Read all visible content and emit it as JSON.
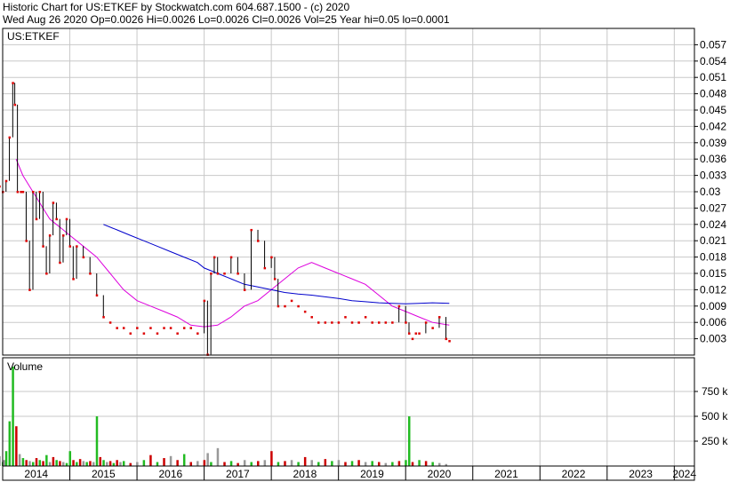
{
  "header": {
    "line1": "Historic Chart for US:ETKEF by Stockwatch.com 604.687.1500 - (c) 2020",
    "line2": "Wed Aug 26 2020   Op=0.0026  Hi=0.0026  Lo=0.0026  Cl=0.0026  Vol=25   Year hi=0.05   lo=0.0001"
  },
  "colors": {
    "price": "#dd0000",
    "ma_short": "#dd00dd",
    "ma_long": "#0000cc",
    "vol_up": "#22bb22",
    "vol_down": "#cc0000",
    "vol_flat": "#999999",
    "grid": "#c8c8c8"
  },
  "chart_data": [
    {
      "type": "line",
      "title": "US:ETKEF",
      "x_ticks": [
        "2014",
        "2015",
        "2016",
        "2017",
        "2018",
        "2019",
        "2020",
        "2021",
        "2022",
        "2023",
        "2024"
      ],
      "y_ticks": [
        "0.057",
        "0.054",
        "0.051",
        "0.048",
        "0.045",
        "0.042",
        "0.039",
        "0.036",
        "0.033",
        "0.03",
        "0.027",
        "0.024",
        "0.021",
        "0.018",
        "0.015",
        "0.012",
        "0.009",
        "0.006",
        "0.003"
      ],
      "xlim": [
        2014.0,
        2024.3
      ],
      "ylim": [
        0.0,
        0.06
      ],
      "grid": true,
      "series": [
        {
          "key": "price",
          "x": [
            2013.9,
            2013.95,
            2014.0,
            2014.05,
            2014.1,
            2014.15,
            2014.18,
            2014.22,
            2014.27,
            2014.3,
            2014.35,
            2014.4,
            2014.45,
            2014.5,
            2014.55,
            2014.6,
            2014.65,
            2014.7,
            2014.75,
            2014.8,
            2014.85,
            2014.9,
            2014.95,
            2015.0,
            2015.05,
            2015.1,
            2015.2,
            2015.3,
            2015.4,
            2015.5,
            2015.6,
            2015.7,
            2015.8,
            2015.9,
            2016.0,
            2016.1,
            2016.2,
            2016.3,
            2016.4,
            2016.5,
            2016.6,
            2016.7,
            2016.8,
            2016.9,
            2017.0,
            2017.05,
            2017.1,
            2017.15,
            2017.2,
            2017.3,
            2017.4,
            2017.5,
            2017.6,
            2017.7,
            2017.8,
            2017.9,
            2018.0,
            2018.05,
            2018.1,
            2018.2,
            2018.3,
            2018.4,
            2018.5,
            2018.6,
            2018.7,
            2018.8,
            2018.9,
            2019.0,
            2019.1,
            2019.2,
            2019.3,
            2019.4,
            2019.5,
            2019.6,
            2019.7,
            2019.8,
            2019.9,
            2020.0,
            2020.05,
            2020.1,
            2020.15,
            2020.2,
            2020.3,
            2020.4,
            2020.5,
            2020.6,
            2020.65
          ],
          "y": [
            0.036,
            0.031,
            0.03,
            0.032,
            0.04,
            0.05,
            0.046,
            0.03,
            0.03,
            0.03,
            0.021,
            0.012,
            0.03,
            0.025,
            0.03,
            0.02,
            0.015,
            0.022,
            0.028,
            0.025,
            0.017,
            0.022,
            0.025,
            0.02,
            0.014,
            0.02,
            0.018,
            0.015,
            0.011,
            0.007,
            0.006,
            0.005,
            0.005,
            0.004,
            0.005,
            0.004,
            0.005,
            0.004,
            0.005,
            0.005,
            0.004,
            0.005,
            0.005,
            0.004,
            0.01,
            0.0001,
            0.015,
            0.018,
            0.015,
            0.015,
            0.018,
            0.015,
            0.012,
            0.023,
            0.021,
            0.016,
            0.018,
            0.014,
            0.009,
            0.009,
            0.01,
            0.009,
            0.008,
            0.007,
            0.006,
            0.006,
            0.006,
            0.006,
            0.007,
            0.006,
            0.006,
            0.007,
            0.006,
            0.006,
            0.006,
            0.006,
            0.009,
            0.006,
            0.004,
            0.003,
            0.004,
            0.004,
            0.006,
            0.005,
            0.007,
            0.003,
            0.0026
          ]
        },
        {
          "key": "ma_short",
          "x": [
            2014.2,
            2014.3,
            2014.4,
            2014.5,
            2014.6,
            2014.7,
            2014.8,
            2014.9,
            2015.0,
            2015.2,
            2015.4,
            2015.6,
            2015.8,
            2016.0,
            2016.2,
            2016.4,
            2016.6,
            2016.8,
            2017.0,
            2017.2,
            2017.4,
            2017.6,
            2017.8,
            2018.0,
            2018.2,
            2018.4,
            2018.6,
            2018.8,
            2019.0,
            2019.2,
            2019.4,
            2019.6,
            2019.8,
            2020.0,
            2020.2,
            2020.4,
            2020.65
          ],
          "y": [
            0.036,
            0.033,
            0.031,
            0.029,
            0.027,
            0.025,
            0.024,
            0.023,
            0.022,
            0.02,
            0.018,
            0.015,
            0.012,
            0.01,
            0.009,
            0.008,
            0.007,
            0.0055,
            0.0052,
            0.0055,
            0.007,
            0.009,
            0.01,
            0.012,
            0.014,
            0.016,
            0.017,
            0.016,
            0.015,
            0.014,
            0.013,
            0.011,
            0.009,
            0.008,
            0.007,
            0.006,
            0.0055
          ]
        },
        {
          "key": "ma_long",
          "x": [
            2015.5,
            2015.7,
            2015.9,
            2016.1,
            2016.3,
            2016.5,
            2016.7,
            2016.9,
            2017.0,
            2017.2,
            2017.4,
            2017.6,
            2017.8,
            2018.0,
            2018.2,
            2018.4,
            2018.6,
            2018.8,
            2019.0,
            2019.2,
            2019.4,
            2019.6,
            2019.8,
            2020.0,
            2020.2,
            2020.4,
            2020.65
          ],
          "y": [
            0.024,
            0.023,
            0.022,
            0.021,
            0.02,
            0.019,
            0.018,
            0.017,
            0.016,
            0.015,
            0.014,
            0.013,
            0.0125,
            0.012,
            0.0115,
            0.0112,
            0.011,
            0.0107,
            0.0104,
            0.01,
            0.0098,
            0.0096,
            0.0095,
            0.0094,
            0.0095,
            0.0096,
            0.0095
          ]
        }
      ]
    },
    {
      "type": "bar",
      "title": "Volume",
      "y_ticks": [
        "750 k",
        "500 k",
        "250 k"
      ],
      "y_tick_values": [
        750000,
        500000,
        250000
      ],
      "ylim": [
        0,
        1000000
      ],
      "xlim": [
        2014.0,
        2024.3
      ],
      "bars": {
        "x": [
          2013.95,
          2014.0,
          2014.02,
          2014.05,
          2014.1,
          2014.15,
          2014.2,
          2014.25,
          2014.3,
          2014.35,
          2014.4,
          2014.45,
          2014.5,
          2014.55,
          2014.6,
          2014.65,
          2014.7,
          2014.75,
          2014.8,
          2014.85,
          2014.9,
          2014.95,
          2015.0,
          2015.05,
          2015.1,
          2015.15,
          2015.2,
          2015.25,
          2015.3,
          2015.35,
          2015.4,
          2015.45,
          2015.5,
          2015.55,
          2015.6,
          2015.65,
          2015.7,
          2015.75,
          2015.8,
          2015.9,
          2016.0,
          2016.1,
          2016.2,
          2016.3,
          2016.4,
          2016.5,
          2016.6,
          2016.7,
          2016.8,
          2016.9,
          2017.0,
          2017.05,
          2017.1,
          2017.2,
          2017.3,
          2017.4,
          2017.5,
          2017.6,
          2017.7,
          2017.8,
          2017.9,
          2018.0,
          2018.1,
          2018.2,
          2018.3,
          2018.4,
          2018.5,
          2018.6,
          2018.7,
          2018.8,
          2018.9,
          2019.0,
          2019.1,
          2019.2,
          2019.3,
          2019.4,
          2019.5,
          2019.6,
          2019.7,
          2019.8,
          2019.9,
          2020.0,
          2020.05,
          2020.1,
          2020.2,
          2020.3,
          2020.4,
          2020.5,
          2020.6
        ],
        "values": [
          100000,
          40000,
          60000,
          150000,
          450000,
          1000000,
          400000,
          120000,
          80000,
          60000,
          50000,
          40000,
          80000,
          60000,
          50000,
          110000,
          40000,
          90000,
          60000,
          50000,
          40000,
          30000,
          150000,
          60000,
          40000,
          70000,
          50000,
          40000,
          50000,
          40000,
          500000,
          90000,
          60000,
          40000,
          50000,
          30000,
          60000,
          40000,
          50000,
          30000,
          40000,
          60000,
          110000,
          40000,
          80000,
          100000,
          60000,
          120000,
          40000,
          50000,
          60000,
          130000,
          40000,
          180000,
          40000,
          50000,
          30000,
          60000,
          40000,
          50000,
          60000,
          150000,
          40000,
          50000,
          60000,
          40000,
          90000,
          60000,
          40000,
          70000,
          50000,
          60000,
          40000,
          50000,
          60000,
          40000,
          50000,
          40000,
          30000,
          40000,
          50000,
          60000,
          500000,
          40000,
          60000,
          50000,
          40000,
          30000,
          20000
        ],
        "dir": [
          "flat",
          "up",
          "flat",
          "up",
          "up",
          "up",
          "down",
          "flat",
          "up",
          "down",
          "flat",
          "up",
          "down",
          "up",
          "down",
          "up",
          "flat",
          "down",
          "up",
          "down",
          "flat",
          "up",
          "up",
          "down",
          "up",
          "down",
          "flat",
          "up",
          "down",
          "flat",
          "up",
          "down",
          "up",
          "flat",
          "down",
          "up",
          "down",
          "flat",
          "up",
          "down",
          "flat",
          "up",
          "down",
          "up",
          "down",
          "flat",
          "down",
          "up",
          "down",
          "flat",
          "down",
          "flat",
          "up",
          "flat",
          "down",
          "up",
          "down",
          "flat",
          "up",
          "down",
          "flat",
          "down",
          "up",
          "down",
          "flat",
          "up",
          "down",
          "flat",
          "up",
          "down",
          "up",
          "flat",
          "down",
          "up",
          "down",
          "flat",
          "up",
          "down",
          "flat",
          "up",
          "down",
          "up",
          "up",
          "down",
          "up",
          "down",
          "up",
          "flat",
          "flat"
        ]
      }
    }
  ]
}
